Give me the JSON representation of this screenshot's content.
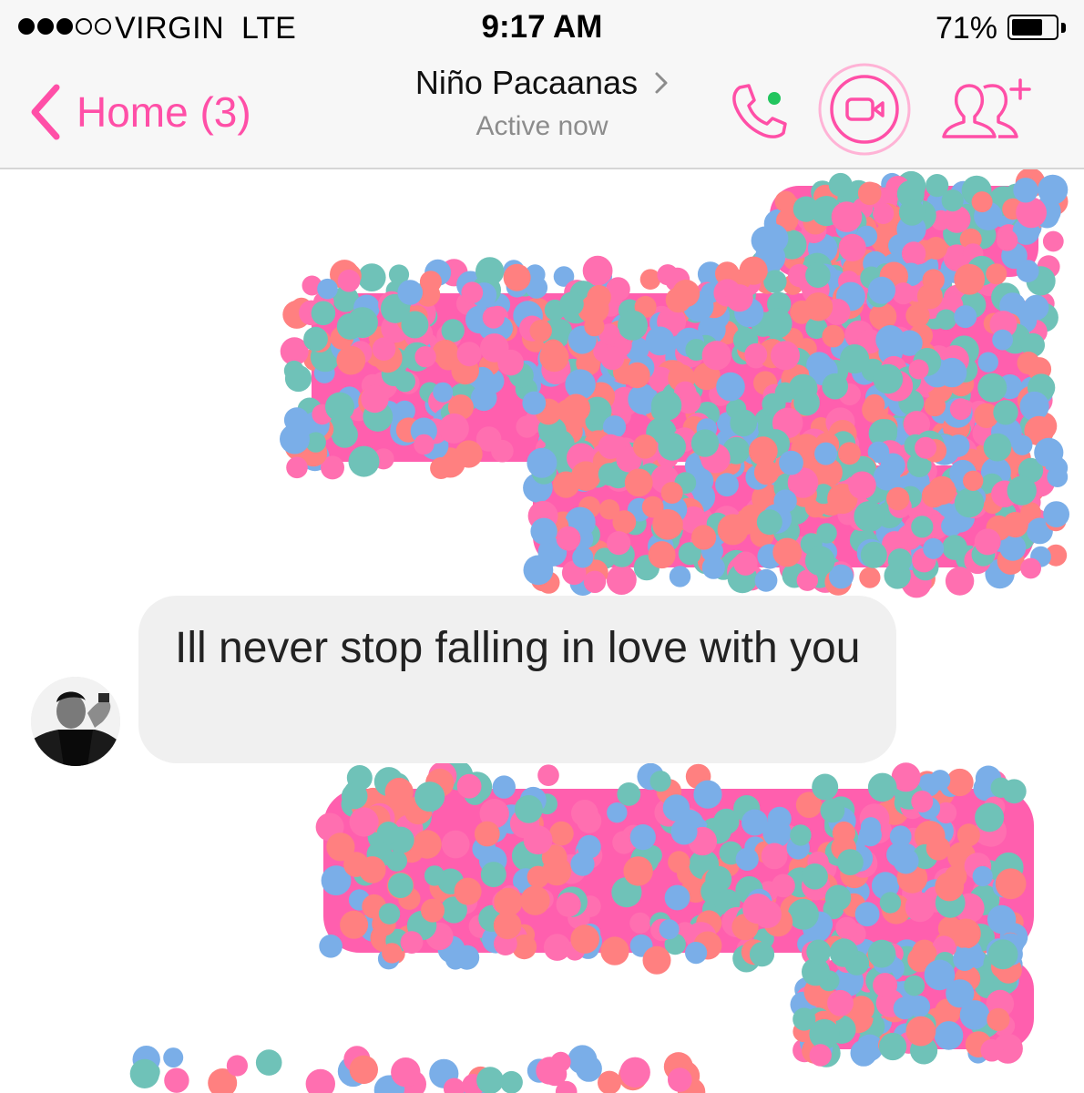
{
  "accent_color": "#ff4fa7",
  "status_bar": {
    "carrier": "VIRGIN",
    "network": "LTE",
    "time": "9:17 AM",
    "battery_percent": "71%",
    "battery_level": 0.71,
    "signal_bars_filled": 3,
    "signal_bars_total": 5
  },
  "nav": {
    "back_label": "Home (3)",
    "back_icon": "chevron-left-icon",
    "contact_name": "Niño Pacaanas",
    "contact_status": "Active now",
    "icons": [
      "phone-call-icon",
      "video-call-icon",
      "add-people-icon"
    ],
    "online_indicator_color": "#22c55e"
  },
  "conversation": {
    "messages": [
      {
        "direction": "incoming",
        "text": "Ill never stop falling in love with you",
        "avatar": "contact-avatar"
      }
    ],
    "redacted_bubble_color": "#ff5fae",
    "scribble_colors": [
      "#ff6fb0",
      "#6fc2b8",
      "#7aaee8",
      "#ff8080"
    ]
  }
}
